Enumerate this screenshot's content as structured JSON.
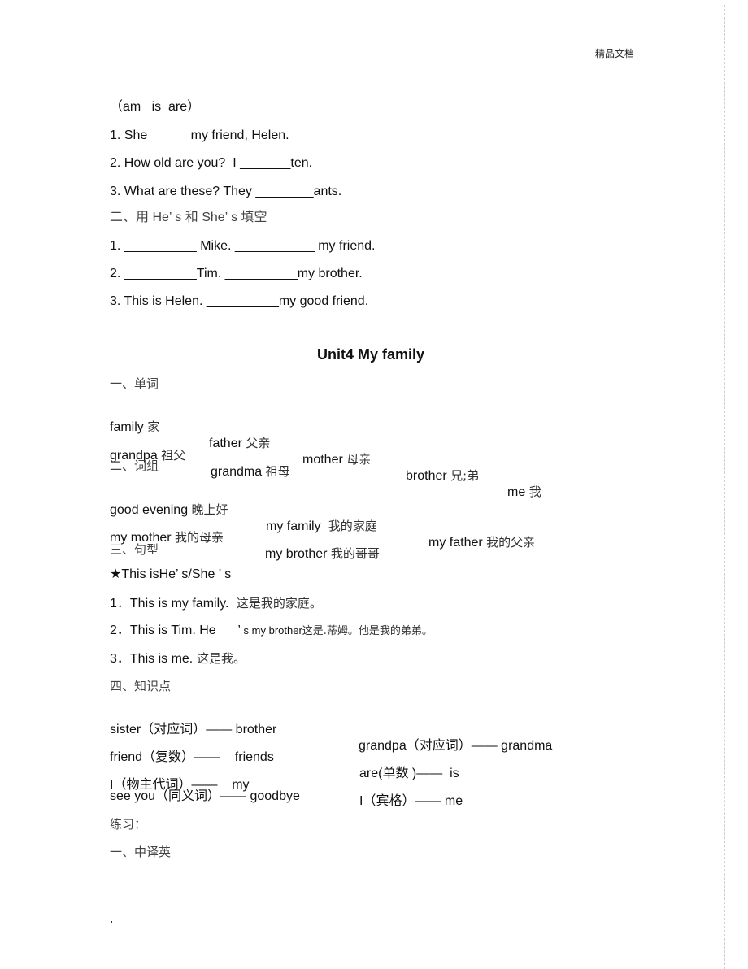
{
  "header": {
    "label": "精品文档"
  },
  "exercise_part1": {
    "options": "（am   is  are）",
    "items": [
      "1. She______my friend, Helen.",
      "2. How old are you?  I _______ten.",
      "3. What are these? They ________ants."
    ]
  },
  "exercise_part2": {
    "heading": "二、用 He’ s 和 She’ s 填空",
    "items": [
      "1. __________ Mike. ___________ my friend.",
      "2. __________Tim. __________my brother.",
      "3. This is Helen. __________my good friend."
    ]
  },
  "unit": {
    "title": "Unit4 My family",
    "section1": {
      "heading": "一、单词",
      "words_row1": [
        {
          "en": "family",
          "cn": "家"
        },
        {
          "en": "father",
          "cn": "父亲"
        },
        {
          "en": "mother",
          "cn": "母亲"
        },
        {
          "en": "brother",
          "cn": "兄;弟"
        },
        {
          "en": "me",
          "cn": "我"
        }
      ],
      "words_row2": [
        {
          "en": "grandpa",
          "cn": "祖父"
        },
        {
          "en": "grandma",
          "cn": "祖母"
        }
      ]
    },
    "section2": {
      "heading": "二、词组",
      "phrases_row1": [
        {
          "en": "good evening",
          "cn": "晚上好"
        },
        {
          "en": "my family",
          "cn": " 我的家庭"
        },
        {
          "en": "my father",
          "cn": "我的父亲"
        }
      ],
      "phrases_row2": [
        {
          "en": "my mother",
          "cn": "我的母亲"
        },
        {
          "en": "my brother",
          "cn": "我的哥哥"
        }
      ]
    },
    "section3": {
      "heading": "三、句型",
      "pattern": "★This isHe’ s/She ’ s",
      "sentences": [
        {
          "en": "1．This is my family.",
          "cn": "  这是我的家庭。"
        },
        {
          "en": "2．This is Tim. He      ’",
          "en_small": " s my brother",
          "cn": "这是.蒂姆。他是我的弟弟。"
        },
        {
          "en": "3．This is me.",
          "cn": " 这是我。"
        }
      ]
    },
    "section4": {
      "heading": "四、知识点",
      "rows": [
        {
          "left": "sister（对应词）—— brother",
          "right": "grandpa（对应词）—— grandma"
        },
        {
          "left": "friend（复数）——    friends",
          "right": "are(单数 )——  is"
        },
        {
          "left": "I（物主代词）——    my",
          "right": "I（宾格）—— me"
        },
        {
          "left": "see you（同义词）—— goodbye",
          "right": ""
        }
      ]
    },
    "practice": {
      "heading": "练习：",
      "subheading": "一、中译英"
    }
  },
  "footer": {
    "dot": "."
  }
}
